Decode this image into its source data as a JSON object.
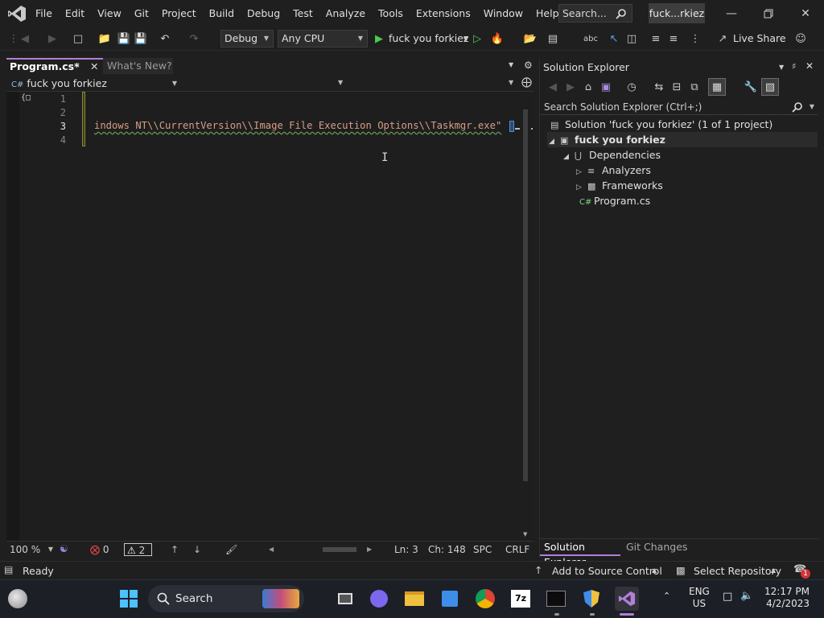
{
  "menu": {
    "items": [
      "File",
      "Edit",
      "View",
      "Git",
      "Project",
      "Build",
      "Debug",
      "Test",
      "Analyze",
      "Tools",
      "Extensions",
      "Window",
      "Help"
    ],
    "search_label": "Search...",
    "title_badge": "fuck...rkiez"
  },
  "toolbar": {
    "config": "Debug",
    "platform": "Any CPU",
    "run_target": "fuck you forkiez",
    "live_share": "Live Share"
  },
  "editor": {
    "tabs": [
      {
        "label": "Program.cs*",
        "active": true
      },
      {
        "label": "What's New?",
        "active": false
      }
    ],
    "nav_project": "fuck you forkiez",
    "line_numbers": [
      "1",
      "2",
      "3",
      "4"
    ],
    "current_line": "3",
    "code_line3": "indows NT\\\\CurrentVersion\\\\Image File Execution Options\\\\Taskmgr.exe\""
  },
  "editor_status": {
    "zoom": "100 %",
    "errors": "0",
    "warnings": "2",
    "line": "Ln: 3",
    "char": "Ch: 148",
    "whitespace": "SPC",
    "line_endings": "CRLF"
  },
  "solution_explorer": {
    "title": "Solution Explorer",
    "search_placeholder": "Search Solution Explorer (Ctrl+;)",
    "solution": "Solution 'fuck you forkiez' (1 of 1 project)",
    "project": "fuck you forkiez",
    "dependencies": "Dependencies",
    "analyzers": "Analyzers",
    "frameworks": "Frameworks",
    "file": "Program.cs",
    "tabs": [
      "Solution Explorer",
      "Git Changes"
    ]
  },
  "statusbar": {
    "ready": "Ready",
    "source_control": "Add to Source Control",
    "repository": "Select Repository",
    "notifications": "1"
  },
  "taskbar": {
    "search": "Search",
    "lang_line1": "ENG",
    "lang_line2": "US",
    "time": "12:17 PM",
    "date": "4/2/2023"
  },
  "colors": {
    "accent": "#b180d7",
    "string": "#d69d85",
    "background": "#1f1f1f",
    "run_green": "#4ec94e"
  }
}
